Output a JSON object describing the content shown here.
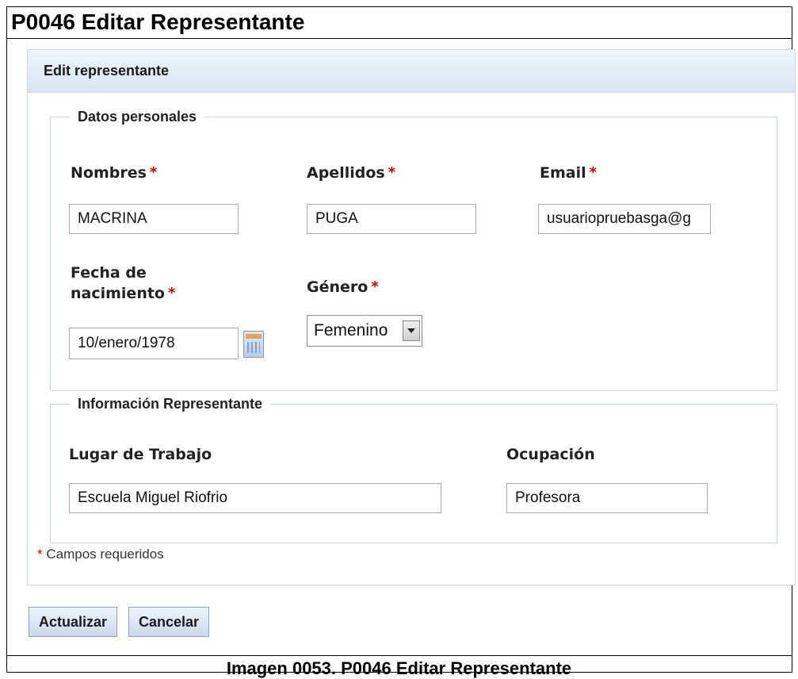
{
  "document": {
    "title": "P0046 Editar Representante",
    "caption": "Imagen 0053. P0046 Editar Representante"
  },
  "panel": {
    "title": "Edit representante"
  },
  "personal": {
    "legend": "Datos personales",
    "nombres": {
      "label": "Nombres",
      "value": "MACRINA"
    },
    "apellidos": {
      "label": "Apellidos",
      "value": "PUGA"
    },
    "email": {
      "label": "Email",
      "value": "usuariopruebasga@g"
    },
    "fecha": {
      "label_line1": "Fecha de",
      "label_line2": "nacimiento",
      "value": "10/enero/1978"
    },
    "genero": {
      "label": "Género",
      "selected": "Femenino"
    }
  },
  "representante": {
    "legend": "Información Representante",
    "lugar": {
      "label": "Lugar de Trabajo",
      "value": "Escuela Miguel Riofrio"
    },
    "ocupacion": {
      "label": "Ocupación",
      "value": "Profesora"
    }
  },
  "required_mark": "*",
  "required_note": "Campos requeridos",
  "buttons": {
    "update": "Actualizar",
    "cancel": "Cancelar"
  },
  "colors": {
    "required": "#cc0000",
    "panel_border": "#c8d6e5",
    "header_bg": "#d9e6f2"
  },
  "icons": {
    "calendar": "calendar-icon",
    "dropdown": "chevron-down-icon"
  }
}
